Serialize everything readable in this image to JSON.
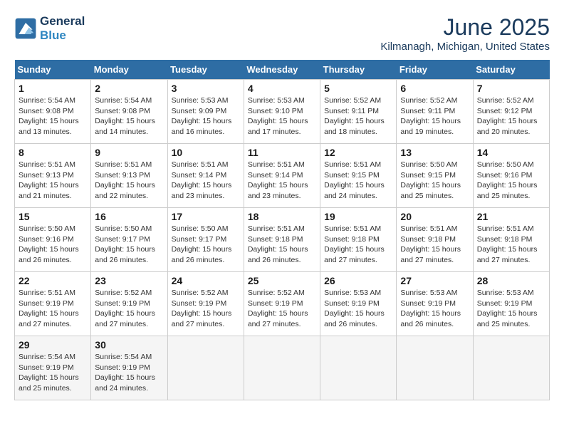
{
  "logo": {
    "line1": "General",
    "line2": "Blue"
  },
  "title": "June 2025",
  "subtitle": "Kilmanagh, Michigan, United States",
  "days_of_week": [
    "Sunday",
    "Monday",
    "Tuesday",
    "Wednesday",
    "Thursday",
    "Friday",
    "Saturday"
  ],
  "weeks": [
    [
      {
        "day": "1",
        "sunrise": "5:54 AM",
        "sunset": "9:08 PM",
        "daylight": "15 hours and 13 minutes."
      },
      {
        "day": "2",
        "sunrise": "5:54 AM",
        "sunset": "9:08 PM",
        "daylight": "15 hours and 14 minutes."
      },
      {
        "day": "3",
        "sunrise": "5:53 AM",
        "sunset": "9:09 PM",
        "daylight": "15 hours and 16 minutes."
      },
      {
        "day": "4",
        "sunrise": "5:53 AM",
        "sunset": "9:10 PM",
        "daylight": "15 hours and 17 minutes."
      },
      {
        "day": "5",
        "sunrise": "5:52 AM",
        "sunset": "9:11 PM",
        "daylight": "15 hours and 18 minutes."
      },
      {
        "day": "6",
        "sunrise": "5:52 AM",
        "sunset": "9:11 PM",
        "daylight": "15 hours and 19 minutes."
      },
      {
        "day": "7",
        "sunrise": "5:52 AM",
        "sunset": "9:12 PM",
        "daylight": "15 hours and 20 minutes."
      }
    ],
    [
      {
        "day": "8",
        "sunrise": "5:51 AM",
        "sunset": "9:13 PM",
        "daylight": "15 hours and 21 minutes."
      },
      {
        "day": "9",
        "sunrise": "5:51 AM",
        "sunset": "9:13 PM",
        "daylight": "15 hours and 22 minutes."
      },
      {
        "day": "10",
        "sunrise": "5:51 AM",
        "sunset": "9:14 PM",
        "daylight": "15 hours and 23 minutes."
      },
      {
        "day": "11",
        "sunrise": "5:51 AM",
        "sunset": "9:14 PM",
        "daylight": "15 hours and 23 minutes."
      },
      {
        "day": "12",
        "sunrise": "5:51 AM",
        "sunset": "9:15 PM",
        "daylight": "15 hours and 24 minutes."
      },
      {
        "day": "13",
        "sunrise": "5:50 AM",
        "sunset": "9:15 PM",
        "daylight": "15 hours and 25 minutes."
      },
      {
        "day": "14",
        "sunrise": "5:50 AM",
        "sunset": "9:16 PM",
        "daylight": "15 hours and 25 minutes."
      }
    ],
    [
      {
        "day": "15",
        "sunrise": "5:50 AM",
        "sunset": "9:16 PM",
        "daylight": "15 hours and 26 minutes."
      },
      {
        "day": "16",
        "sunrise": "5:50 AM",
        "sunset": "9:17 PM",
        "daylight": "15 hours and 26 minutes."
      },
      {
        "day": "17",
        "sunrise": "5:50 AM",
        "sunset": "9:17 PM",
        "daylight": "15 hours and 26 minutes."
      },
      {
        "day": "18",
        "sunrise": "5:51 AM",
        "sunset": "9:18 PM",
        "daylight": "15 hours and 26 minutes."
      },
      {
        "day": "19",
        "sunrise": "5:51 AM",
        "sunset": "9:18 PM",
        "daylight": "15 hours and 27 minutes."
      },
      {
        "day": "20",
        "sunrise": "5:51 AM",
        "sunset": "9:18 PM",
        "daylight": "15 hours and 27 minutes."
      },
      {
        "day": "21",
        "sunrise": "5:51 AM",
        "sunset": "9:18 PM",
        "daylight": "15 hours and 27 minutes."
      }
    ],
    [
      {
        "day": "22",
        "sunrise": "5:51 AM",
        "sunset": "9:19 PM",
        "daylight": "15 hours and 27 minutes."
      },
      {
        "day": "23",
        "sunrise": "5:52 AM",
        "sunset": "9:19 PM",
        "daylight": "15 hours and 27 minutes."
      },
      {
        "day": "24",
        "sunrise": "5:52 AM",
        "sunset": "9:19 PM",
        "daylight": "15 hours and 27 minutes."
      },
      {
        "day": "25",
        "sunrise": "5:52 AM",
        "sunset": "9:19 PM",
        "daylight": "15 hours and 27 minutes."
      },
      {
        "day": "26",
        "sunrise": "5:53 AM",
        "sunset": "9:19 PM",
        "daylight": "15 hours and 26 minutes."
      },
      {
        "day": "27",
        "sunrise": "5:53 AM",
        "sunset": "9:19 PM",
        "daylight": "15 hours and 26 minutes."
      },
      {
        "day": "28",
        "sunrise": "5:53 AM",
        "sunset": "9:19 PM",
        "daylight": "15 hours and 25 minutes."
      }
    ],
    [
      {
        "day": "29",
        "sunrise": "5:54 AM",
        "sunset": "9:19 PM",
        "daylight": "15 hours and 25 minutes."
      },
      {
        "day": "30",
        "sunrise": "5:54 AM",
        "sunset": "9:19 PM",
        "daylight": "15 hours and 24 minutes."
      },
      null,
      null,
      null,
      null,
      null
    ]
  ],
  "labels": {
    "sunrise": "Sunrise: ",
    "sunset": "Sunset: ",
    "daylight": "Daylight: "
  }
}
